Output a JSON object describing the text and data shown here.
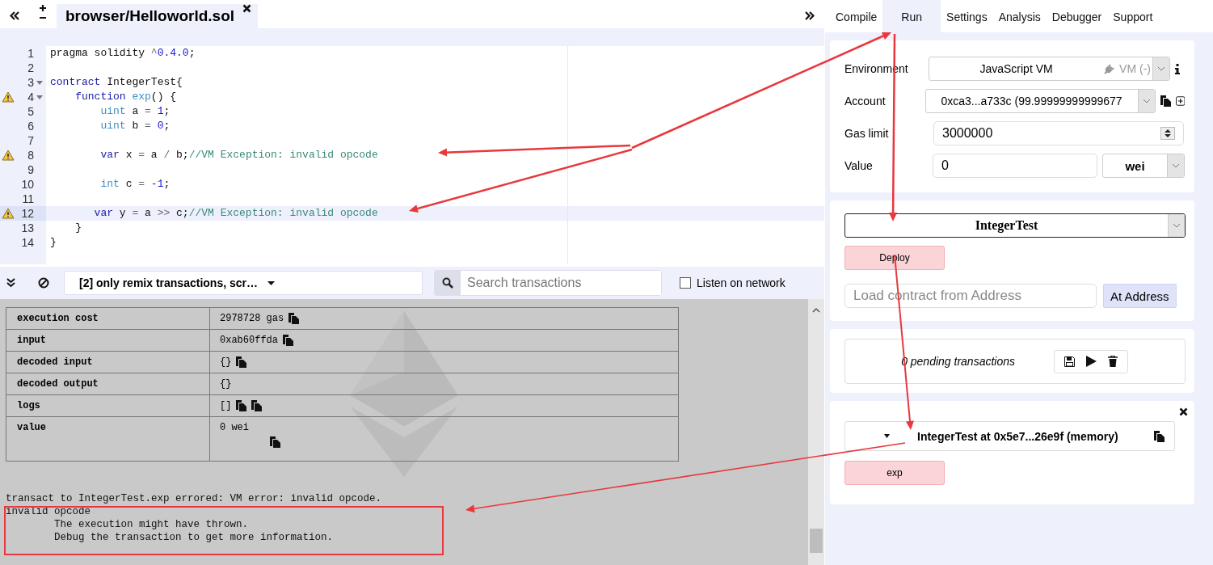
{
  "editor": {
    "tabs": [
      {
        "label": "browser/Helloworld.sol",
        "selected": true
      }
    ],
    "lines": [
      {
        "number": "1",
        "warning": false,
        "foldable": false,
        "highlighted": false,
        "tokens": [
          {
            "kind": "plain",
            "text": "pragma solidity "
          },
          {
            "kind": "operator",
            "text": "^"
          },
          {
            "kind": "number",
            "text": "0.4.0"
          },
          {
            "kind": "plain",
            "text": ";"
          }
        ]
      },
      {
        "number": "2",
        "warning": false,
        "foldable": false,
        "highlighted": false
      },
      {
        "number": "3",
        "warning": false,
        "foldable": true,
        "highlighted": false,
        "tokens": [
          {
            "kind": "keyword",
            "text": "contract"
          },
          {
            "kind": "plain",
            "text": " IntegerTest{"
          }
        ]
      },
      {
        "number": "4",
        "warning": true,
        "foldable": true,
        "highlighted": false,
        "tokens": [
          {
            "kind": "keyword",
            "text": "    function"
          },
          {
            "kind": "type",
            "text": " exp"
          },
          {
            "kind": "plain",
            "text": "() {"
          }
        ]
      },
      {
        "number": "5",
        "warning": false,
        "foldable": false,
        "highlighted": false,
        "tokens": [
          {
            "kind": "type",
            "text": "        uint"
          },
          {
            "kind": "plain",
            "text": " a "
          },
          {
            "kind": "operator",
            "text": "="
          },
          {
            "kind": "number",
            "text": " 1"
          },
          {
            "kind": "plain",
            "text": ";"
          }
        ]
      },
      {
        "number": "6",
        "warning": false,
        "foldable": false,
        "highlighted": false,
        "tokens": [
          {
            "kind": "type",
            "text": "        uint"
          },
          {
            "kind": "plain",
            "text": " b "
          },
          {
            "kind": "operator",
            "text": "="
          },
          {
            "kind": "number",
            "text": " 0"
          },
          {
            "kind": "plain",
            "text": ";"
          }
        ]
      },
      {
        "number": "7",
        "warning": false,
        "foldable": false,
        "highlighted": false
      },
      {
        "number": "8",
        "warning": true,
        "foldable": false,
        "highlighted": false,
        "tokens": [
          {
            "kind": "keyword",
            "text": "        var"
          },
          {
            "kind": "plain",
            "text": " x "
          },
          {
            "kind": "operator",
            "text": "="
          },
          {
            "kind": "plain",
            "text": " a "
          },
          {
            "kind": "operator",
            "text": "/"
          },
          {
            "kind": "plain",
            "text": " b;"
          },
          {
            "kind": "comment",
            "text": "//VM Exception: invalid opcode"
          }
        ]
      },
      {
        "number": "9",
        "warning": false,
        "foldable": false,
        "highlighted": false
      },
      {
        "number": "10",
        "warning": false,
        "foldable": false,
        "highlighted": false,
        "tokens": [
          {
            "kind": "type",
            "text": "        int"
          },
          {
            "kind": "plain",
            "text": " c "
          },
          {
            "kind": "operator",
            "text": "="
          },
          {
            "kind": "number",
            "text": " -1"
          },
          {
            "kind": "plain",
            "text": ";"
          }
        ]
      },
      {
        "number": "11",
        "warning": false,
        "foldable": false,
        "highlighted": false
      },
      {
        "number": "12",
        "warning": true,
        "foldable": false,
        "highlighted": true,
        "tokens": [
          {
            "kind": "keyword",
            "text": "       var"
          },
          {
            "kind": "plain",
            "text": " y "
          },
          {
            "kind": "operator",
            "text": "="
          },
          {
            "kind": "plain",
            "text": " a "
          },
          {
            "kind": "operator",
            "text": ">>"
          },
          {
            "kind": "plain",
            "text": " c;"
          },
          {
            "kind": "comment",
            "text": "//VM Exception: invalid opcode"
          }
        ]
      },
      {
        "number": "13",
        "warning": false,
        "foldable": false,
        "highlighted": false,
        "tokens": [
          {
            "kind": "plain",
            "text": "    }"
          }
        ]
      },
      {
        "number": "14",
        "warning": false,
        "foldable": false,
        "highlighted": false,
        "tokens": [
          {
            "kind": "plain",
            "text": "}"
          }
        ]
      }
    ]
  },
  "terminal": {
    "filter": "[2] only remix transactions, scr…",
    "search": {
      "placeholder": "Search transactions"
    },
    "listen": {
      "label": "Listen on network",
      "checked": false
    },
    "table": [
      {
        "kind": "inline",
        "label": "execution cost",
        "value": "2978728 gas",
        "icons": [
          {
            "kind": "copy"
          }
        ]
      },
      {
        "kind": "inline",
        "label": "input",
        "value": "0xab60ffda",
        "icons": [
          {
            "kind": "copy"
          }
        ]
      },
      {
        "kind": "inline",
        "label": "decoded input",
        "value": "{}",
        "icons": [
          {
            "kind": "copy"
          }
        ]
      },
      {
        "kind": "inline",
        "label": "decoded output",
        "value": "{}"
      },
      {
        "kind": "inline",
        "label": "logs",
        "value": "[]",
        "icons": [
          {
            "kind": "copy"
          },
          {
            "kind": "copy"
          }
        ]
      },
      {
        "kind": "stacked",
        "label": "value",
        "value": "0 wei",
        "icons": [
          {
            "kind": "copy"
          }
        ]
      }
    ],
    "log": [
      "transact to IntegerTest.exp errored: VM error: invalid opcode.",
      "invalid opcode",
      "        The execution might have thrown.",
      "        Debug the transaction to get more information."
    ]
  },
  "run": {
    "tabs": [
      {
        "label": "Compile",
        "selected": false
      },
      {
        "label": "Run",
        "selected": true
      },
      {
        "label": "Settings",
        "selected": false
      },
      {
        "label": "Analysis",
        "selected": false
      },
      {
        "label": "Debugger",
        "selected": false
      },
      {
        "label": "Support",
        "selected": false
      }
    ],
    "environment": {
      "label": "Environment",
      "value": "JavaScript VM",
      "status": "VM (-)"
    },
    "account": {
      "label": "Account",
      "value": "0xca3...a733c (99.99999999999677"
    },
    "gas_limit": {
      "label": "Gas limit",
      "value": "3000000"
    },
    "value": {
      "label": "Value",
      "value": "0",
      "unit": "wei"
    },
    "contract": "IntegerTest",
    "deploy": "Deploy",
    "load": {
      "placeholder": "Load contract from Address",
      "button": "At Address"
    },
    "pending": "0 pending transactions",
    "instance": {
      "title": "IntegerTest at 0x5e7...26e9f (memory)",
      "functions": [
        "exp"
      ]
    }
  }
}
